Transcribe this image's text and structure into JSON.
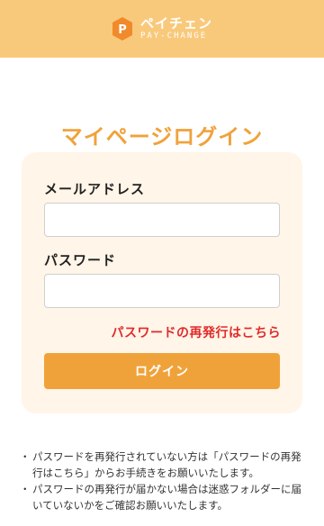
{
  "header": {
    "logo_main": "ペイチェン",
    "logo_sub": "PAY-CHANGE",
    "logo_letter": "P",
    "brand_color": "#f9c97b",
    "logo_mark_color": "#f08a2a"
  },
  "page": {
    "title": "マイページログイン"
  },
  "form": {
    "email_label": "メールアドレス",
    "email_value": "",
    "password_label": "パスワード",
    "password_value": "",
    "reset_link": "パスワードの再発行はこちら",
    "login_button": "ログイン",
    "accent_color": "#f0a23a",
    "link_color": "#e02a2a"
  },
  "notes": [
    "パスワードを再発行されていない方は「パスワードの再発行はこちら」からお手続きをお願いいたします。",
    "パスワードの再発行が届かない場合は迷惑フォルダーに届いていないかをご確認お願いいたします。"
  ]
}
